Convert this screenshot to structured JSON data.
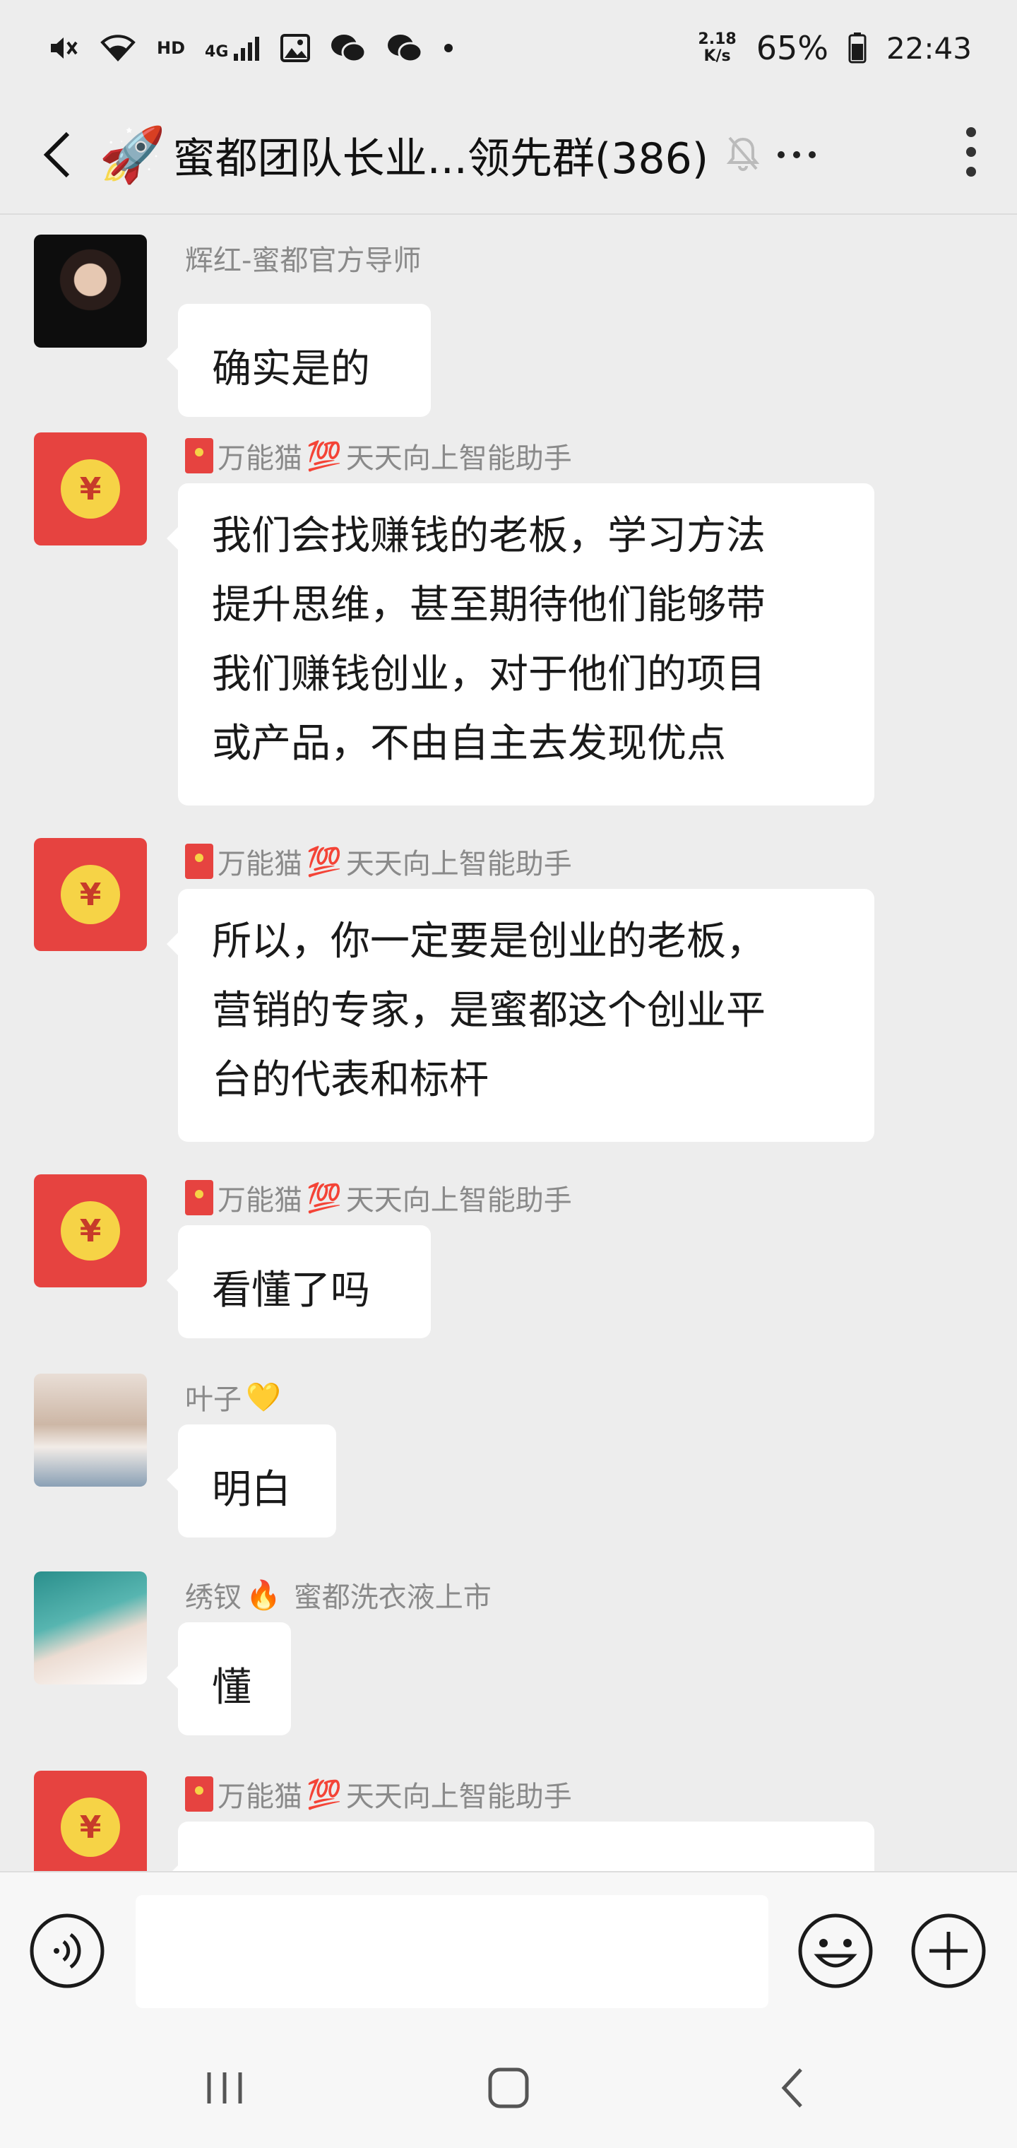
{
  "status_bar": {
    "hd_label": "HD",
    "network_label": "4G",
    "speed_value": "2.18",
    "speed_unit": "K/s",
    "battery_percent": "65%",
    "time": "22:43",
    "icons": [
      "mute-icon",
      "wifi-icon",
      "signal-icon",
      "gallery-icon",
      "wechat-icon",
      "wechat-icon",
      "dot-icon",
      "battery-icon"
    ]
  },
  "header": {
    "title_emoji": "🚀",
    "title": "蜜都团队长业...领先群(386)",
    "icons": [
      "back-arrow-icon",
      "bell-muted-icon",
      "more-dots-icon",
      "kebab-menu-icon"
    ]
  },
  "messages": [
    {
      "sender": "辉红-蜜都官方导师",
      "text": "确实是的",
      "avatar": "woman-photo"
    },
    {
      "sender_prefix_icon": "red-packet-icon",
      "sender_part1": "万能猫",
      "sender_emoji": "💯",
      "sender_part2": "天天向上智能助手",
      "lines": [
        "我们会找赚钱的老板，学习方法",
        "提升思维，甚至期待他们能够带",
        "我们赚钱创业，对于他们的项目",
        "或产品，不由自主去发现优点"
      ],
      "avatar": "red-packet"
    },
    {
      "sender_prefix_icon": "red-packet-icon",
      "sender_part1": "万能猫",
      "sender_emoji": "💯",
      "sender_part2": "天天向上智能助手",
      "lines": [
        "所以，你一定要是创业的老板，",
        "营销的专家，是蜜都这个创业平",
        "台的代表和标杆"
      ],
      "avatar": "red-packet"
    },
    {
      "sender_prefix_icon": "red-packet-icon",
      "sender_part1": "万能猫",
      "sender_emoji": "💯",
      "sender_part2": "天天向上智能助手",
      "text": "看懂了吗",
      "avatar": "red-packet"
    },
    {
      "sender_part1": "叶子",
      "sender_emoji": "💛",
      "text": "明白",
      "avatar": "wedding-photo"
    },
    {
      "sender_part1": "绣钗",
      "sender_emoji": "🔥",
      "sender_part2": "蜜都洗衣液上市",
      "text": "懂",
      "avatar": "girl-photo"
    },
    {
      "sender_prefix_icon": "red-packet-icon",
      "sender_part1": "万能猫",
      "sender_emoji": "💯",
      "sender_part2": "天天向上智能助手",
      "text": "...",
      "avatar": "red-packet"
    }
  ],
  "red_packet_symbol": "¥",
  "input_bar": {
    "value": "",
    "icons": [
      "voice-icon",
      "emoji-face-icon",
      "plus-icon"
    ]
  },
  "nav_bar": {
    "icons": [
      "recent-apps-icon",
      "home-icon",
      "back-icon"
    ]
  }
}
